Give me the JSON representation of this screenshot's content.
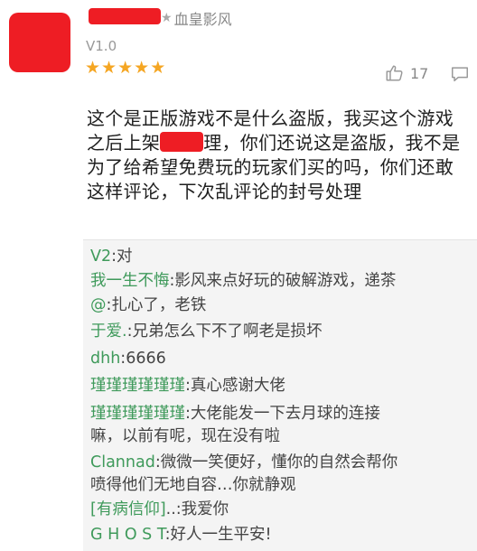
{
  "colors": {
    "redaction": "#ee1d24",
    "star": "#f5a623",
    "username_green": "#3f9a5b",
    "reply_bg": "#f4f4f4"
  },
  "review": {
    "name_suffix": "血皇影风",
    "version": "V1.0",
    "rating": 5,
    "likes": "17",
    "text_part1": "这个是正版游戏不是什么盗版，我买这个游戏之后上架",
    "text_part2": "理，你们还说这是盗版，我不是为了给希望免费玩的玩家们买的吗，你们还敢这样评论，下次乱评论的封号处理"
  },
  "replies": [
    {
      "name": "V2",
      "text": ":对"
    },
    {
      "name": "我一生不悔",
      "text": ":影风来点好玩的破解游戏，递茶"
    },
    {
      "name": "@",
      "text": ":扎心了，老铁"
    },
    {
      "name": "于爱.",
      "text": ":兄弟怎么下不了啊老是损坏"
    },
    {
      "name": "dhh",
      "text": ":6666"
    },
    {
      "name": "瑾瑾瑾瑾瑾瑾",
      "text": ":真心感谢大佬"
    },
    {
      "name": "瑾瑾瑾瑾瑾瑾",
      "text": ":大佬能发一下去月球的连接",
      "text2": "嘛，以前有呢，现在没有啦"
    },
    {
      "name": "Clannad",
      "text": ":微微一笑便好，懂你的自然会帮你",
      "text2": "喷得他们无地自容…你就静观"
    },
    {
      "name": "[有病信仰]",
      "text": "..:我爱你"
    },
    {
      "name": "G H O S T",
      "text": ":好人一生平安!"
    }
  ]
}
